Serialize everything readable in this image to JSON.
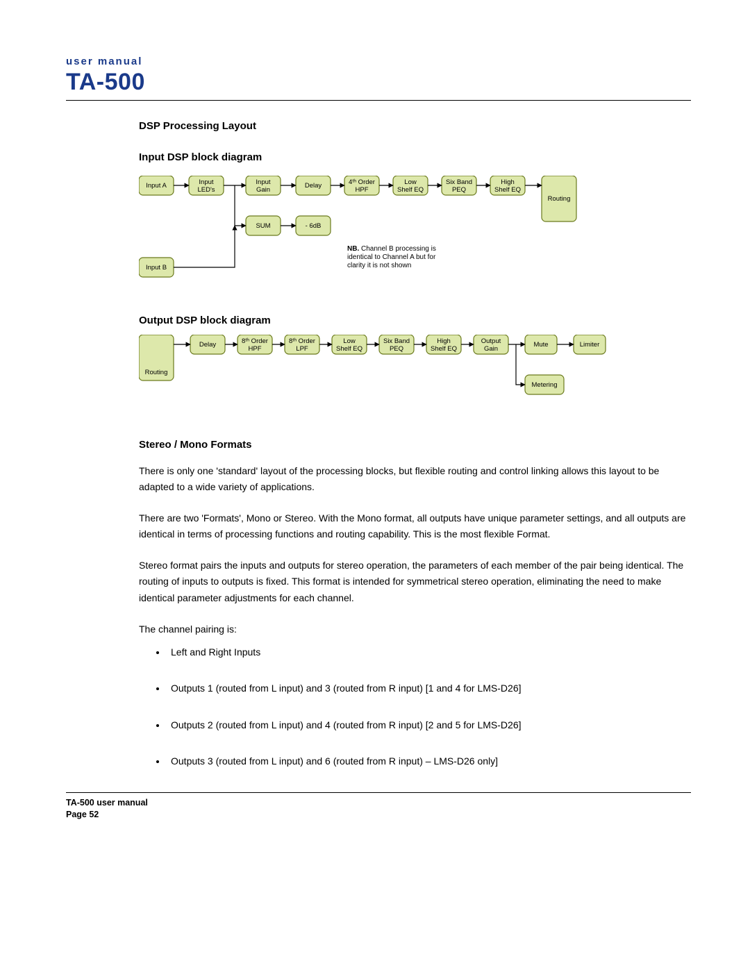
{
  "header": {
    "subtitle": "user manual",
    "title": "TA-500"
  },
  "section_title": "DSP Processing Layout",
  "input_title": "Input DSP block diagram",
  "output_title": "Output DSP block diagram",
  "input_blocks": {
    "a": "Input A",
    "leds": "Input\nLED's",
    "gain": "Input\nGain",
    "delay": "Delay",
    "hpf": "4ᵗʰ Order\nHPF",
    "low": "Low\nShelf EQ",
    "peq": "Six Band\nPEQ",
    "high": "High\nShelf EQ",
    "routing": "Routing",
    "sum": "SUM",
    "m6": "- 6dB",
    "b": "Input B"
  },
  "note_bold": "NB.",
  "note_rest": " Channel B processing is identical to Channel A but for clarity it is not shown",
  "output_blocks": {
    "routing": "Routing",
    "delay": "Delay",
    "hpf": "8ᵗʰ Order\nHPF",
    "lpf": "8ᵗʰ Order\nLPF",
    "low": "Low\nShelf EQ",
    "peq": "Six Band\nPEQ",
    "high": "High\nShelf EQ",
    "gain": "Output\nGain",
    "mute": "Mute",
    "limiter": "Limiter",
    "metering": "Metering"
  },
  "formats_title": "Stereo / Mono Formats",
  "para1": "There is only one 'standard' layout of the processing blocks, but flexible routing and control linking allows this layout to be adapted to a wide variety of applications.",
  "para2": "There are two 'Formats', Mono or Stereo. With the Mono format, all outputs have unique parameter settings, and all outputs are identical in terms of processing functions and routing capability. This is the most flexible Format.",
  "para3": "Stereo format pairs the inputs and outputs for stereo operation, the parameters of each member of the pair being identical. The routing of inputs to outputs is fixed. This format is intended for symmetrical stereo operation, eliminating the need to make identical parameter adjustments for each channel.",
  "para4": "The channel pairing is:",
  "bullets": [
    "Left and Right Inputs",
    "Outputs 1 (routed from L input) and 3 (routed from R input) [1 and 4 for LMS-D26]",
    "Outputs 2 (routed from L input) and 4 (routed from R input) [2 and 5 for LMS-D26]",
    "Outputs 3 (routed from L input) and 6 (routed from R input) – LMS-D26 only]"
  ],
  "footer_line1": "TA-500 user manual",
  "footer_line2": "Page 52"
}
